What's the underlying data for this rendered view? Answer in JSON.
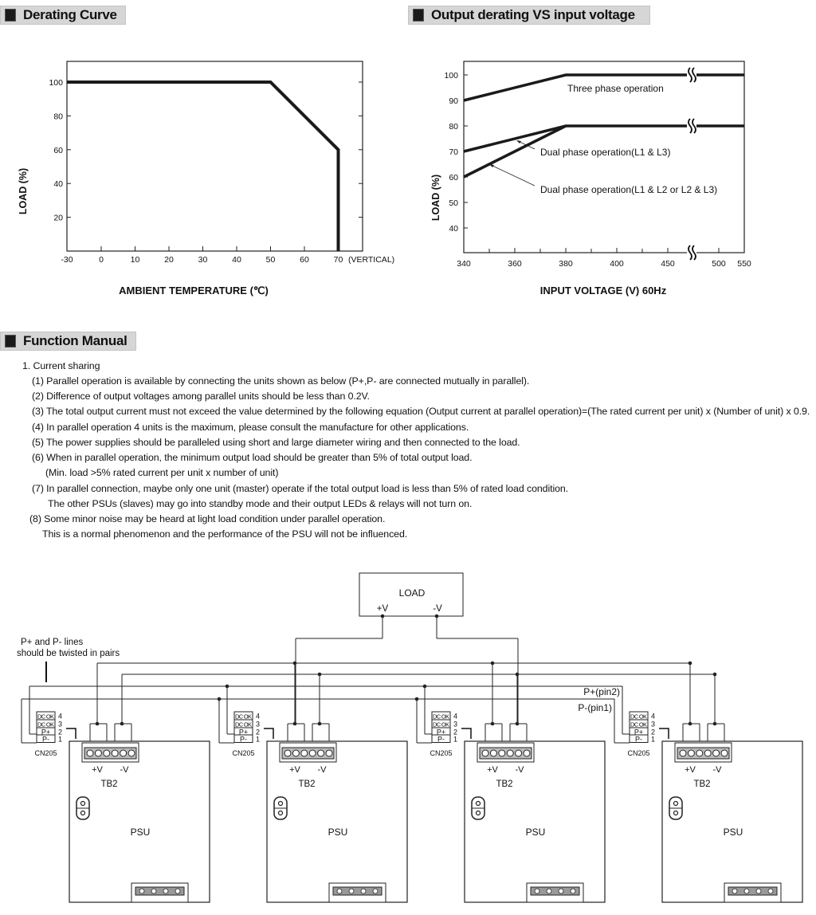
{
  "headers": {
    "derating": "Derating Curve",
    "output_derating": "Output derating VS input voltage",
    "function_manual": "Function Manual"
  },
  "chart_data": [
    {
      "type": "line",
      "title": "Derating Curve",
      "xlabel": "AMBIENT TEMPERATURE (℃)",
      "ylabel": "LOAD (%)",
      "x_ticks": [
        "-30",
        "0",
        "10",
        "20",
        "30",
        "40",
        "50",
        "60",
        "70"
      ],
      "x_tick_values": [
        -30,
        0,
        10,
        20,
        30,
        40,
        50,
        60,
        70
      ],
      "x_annotation": "(VERTICAL)",
      "y_ticks": [
        "100",
        "80",
        "60",
        "40",
        "20"
      ],
      "y_tick_values": [
        100,
        80,
        60,
        40,
        20
      ],
      "xlim": [
        -30,
        80
      ],
      "ylim": [
        0,
        110
      ],
      "grid": false,
      "series": [
        {
          "x": [
            -30,
            50,
            70,
            70
          ],
          "y": [
            100,
            100,
            60,
            0
          ]
        }
      ]
    },
    {
      "type": "line",
      "title": "Output derating VS input voltage",
      "xlabel": "INPUT VOLTAGE (V) 60Hz",
      "ylabel": "LOAD (%)",
      "x_ticks": [
        "340",
        "360",
        "380",
        "400",
        "450",
        "500",
        "550"
      ],
      "x_tick_values": [
        340,
        360,
        380,
        400,
        450,
        500,
        550
      ],
      "x_axis_break": "between 450 and 500",
      "y_ticks": [
        "100",
        "90",
        "80",
        "70",
        "60",
        "50",
        "40"
      ],
      "y_tick_values": [
        100,
        90,
        80,
        70,
        60,
        50,
        40
      ],
      "ylim": [
        30,
        105
      ],
      "grid": false,
      "series": [
        {
          "name": "Three phase operation",
          "x": [
            340,
            380,
            550
          ],
          "y": [
            90,
            100,
            100
          ]
        },
        {
          "name": "Dual phase operation(L1 & L3)",
          "x": [
            340,
            380,
            550
          ],
          "y": [
            70,
            80,
            80
          ]
        },
        {
          "name": "Dual phase operation(L1 & L2 or L2 & L3)",
          "x": [
            340,
            380
          ],
          "y": [
            60,
            80
          ]
        }
      ]
    }
  ],
  "manual": {
    "lines": [
      "1. Current sharing",
      "(1) Parallel operation is available by connecting the units shown as below (P+,P- are connected mutually in parallel).",
      "(2) Difference of output voltages among parallel units should be less than 0.2V.",
      "(3) The total output current must not exceed the value determined by the following equation (Output current at parallel operation)=(The rated current per unit) x (Number of unit) x 0.9.",
      "(4) In parallel operation 4 units is the maximum, please consult the manufacture for other applications.",
      "(5) The power supplies should be paralleled using short and large diameter wiring and then connected to the load.",
      "(6) When in parallel operation, the minimum output load should be greater than 5% of total output load.",
      "(Min. load >5% rated current per unit x number of unit)",
      "(7) In parallel connection, maybe only one unit (master) operate if the total output load is less than 5% of rated load condition.",
      "The other PSUs (slaves) may go into standby mode and their output LEDs & relays will not turn on.",
      "(8) Some minor noise may be heard at light load condition under parallel operation.",
      "This is a normal phenomenon and the performance of the PSU will not be influenced."
    ]
  },
  "diagram": {
    "load_label": "LOAD",
    "load_plus": "+V",
    "load_minus": "-V",
    "twist_note_1": "P+  and P-  lines",
    "twist_note_2": "should be twisted in pairs",
    "pplus_line": "P+(pin2)",
    "pminus_line": "P-(pin1)",
    "unit": {
      "dcok": "DC OK",
      "pplus": "P+",
      "pminus": "P-",
      "pins": [
        "4",
        "3",
        "2",
        "1"
      ],
      "connector": "CN205",
      "tb_plus": "+V",
      "tb_minus": "-V",
      "tb_label": "TB2",
      "psu_label": "PSU"
    },
    "unit_count": 4
  }
}
